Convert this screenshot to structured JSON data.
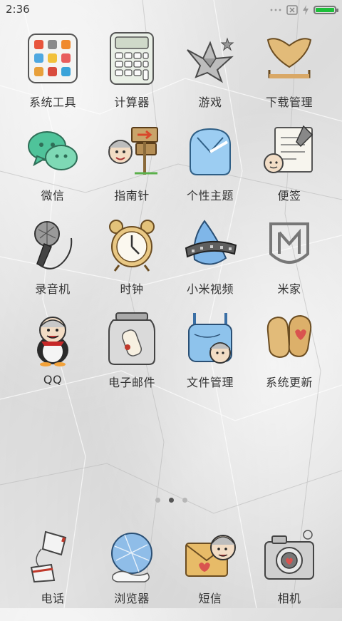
{
  "status_bar": {
    "time": "2:36",
    "battery_color": "#1dbf3a"
  },
  "apps": [
    {
      "label": "系统工具",
      "icon": "system-tools-folder-icon"
    },
    {
      "label": "计算器",
      "icon": "calculator-icon"
    },
    {
      "label": "游戏",
      "icon": "paper-crane-game-icon"
    },
    {
      "label": "下载管理",
      "icon": "download-manager-icon"
    },
    {
      "label": "微信",
      "icon": "wechat-icon"
    },
    {
      "label": "指南针",
      "icon": "compass-signpost-icon"
    },
    {
      "label": "个性主题",
      "icon": "themes-shirt-icon"
    },
    {
      "label": "便签",
      "icon": "notes-icon"
    },
    {
      "label": "录音机",
      "icon": "microphone-recorder-icon"
    },
    {
      "label": "时钟",
      "icon": "alarm-clock-icon"
    },
    {
      "label": "小米视频",
      "icon": "video-player-icon"
    },
    {
      "label": "米家",
      "icon": "mijia-icon"
    },
    {
      "label": "QQ",
      "icon": "qq-penguin-icon"
    },
    {
      "label": "电子邮件",
      "icon": "email-jar-icon"
    },
    {
      "label": "文件管理",
      "icon": "file-manager-bag-icon"
    },
    {
      "label": "系统更新",
      "icon": "system-update-mitten-icon"
    }
  ],
  "page_indicator": {
    "pages": 3,
    "active": 2
  },
  "dock": [
    {
      "label": "电话",
      "icon": "phone-cup-icon"
    },
    {
      "label": "浏览器",
      "icon": "browser-globe-icon"
    },
    {
      "label": "短信",
      "icon": "sms-envelope-icon"
    },
    {
      "label": "相机",
      "icon": "camera-icon"
    }
  ]
}
